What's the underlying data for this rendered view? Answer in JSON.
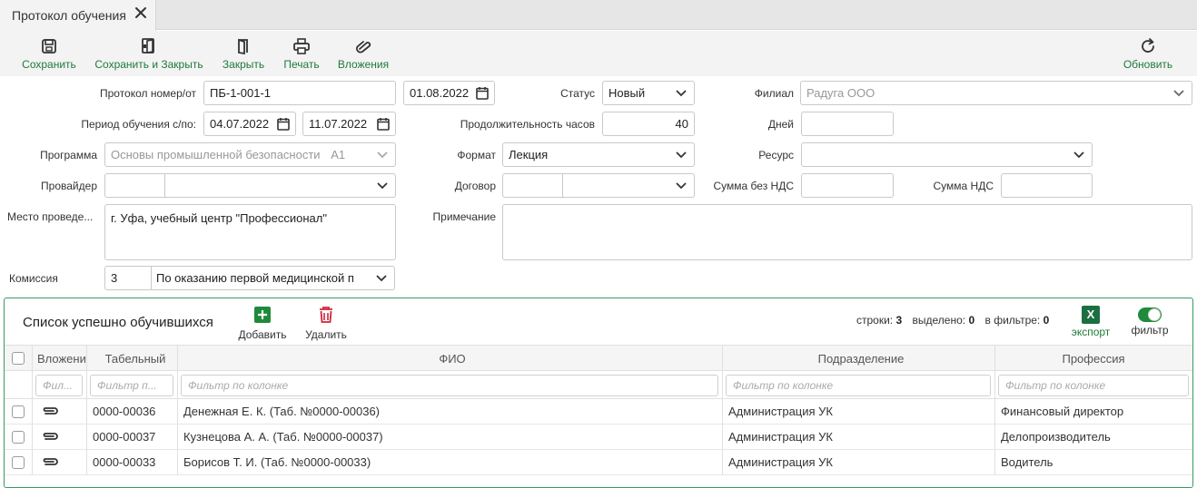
{
  "tab": {
    "title": "Протокол обучения"
  },
  "toolbar": {
    "save": "Сохранить",
    "save_close": "Сохранить и Закрыть",
    "close": "Закрыть",
    "print": "Печать",
    "attachments": "Вложения",
    "refresh": "Обновить"
  },
  "form": {
    "protocol_label": "Протокол номер/от",
    "protocol_number": "ПБ-1-001-1",
    "protocol_date": "01.08.2022",
    "period_label": "Период обучения с/по:",
    "period_from": "04.07.2022",
    "period_to": "11.07.2022",
    "program_label": "Программа",
    "program_value": "Основы промышленной безопасности",
    "program_code": "А1",
    "provider_label": "Провайдер",
    "place_label": "Место проведе...",
    "place_value": "г. Уфа, учебный центр \"Профессионал\"",
    "commission_label": "Комиссия",
    "commission_code": "3",
    "commission_value": "По оказанию первой медицинской п",
    "status_label": "Статус",
    "status_value": "Новый",
    "duration_label": "Продолжительность часов",
    "duration_value": "40",
    "format_label": "Формат",
    "format_value": "Лекция",
    "contract_label": "Договор",
    "note_label": "Примечание",
    "branch_label": "Филиал",
    "branch_value": "Радуга ООО",
    "days_label": "Дней",
    "resource_label": "Ресурс",
    "sum_no_vat_label": "Сумма без НДС",
    "vat_label": "Сумма НДС"
  },
  "panel": {
    "title": "Список успешно обучившихся",
    "add": "Добавить",
    "delete": "Удалить",
    "rows_label": "строки:",
    "rows_count": "3",
    "selected_label": "выделено:",
    "selected_count": "0",
    "in_filter_label": "в фильтре:",
    "in_filter_count": "0",
    "excel_icon_letter": "X",
    "export": "экспорт",
    "filter": "фильтр"
  },
  "grid": {
    "columns": {
      "attachments": "Вложени",
      "tab_number": "Табельный",
      "fio": "ФИО",
      "department": "Подразделение",
      "profession": "Профессия"
    },
    "filters": {
      "attachments": "Фил...",
      "tab_number": "Фильтр п...",
      "fio": "Фильтр по колонке",
      "department": "Фильтр по колонке",
      "profession": "Фильтр по колонке"
    },
    "rows": [
      {
        "tab_number": "0000-00036",
        "fio": "Денежная Е. К. (Таб. №0000-00036)",
        "department": "Администрация УК",
        "profession": "Финансовый директор"
      },
      {
        "tab_number": "0000-00037",
        "fio": "Кузнецова А. А. (Таб. №0000-00037)",
        "department": "Администрация УК",
        "profession": "Делопроизводитель"
      },
      {
        "tab_number": "0000-00033",
        "fio": "Борисов Т. И. (Таб. №0000-00033)",
        "department": "Администрация УК",
        "profession": "Водитель"
      }
    ]
  },
  "colors": {
    "accent_green": "#1f7a3a",
    "excel_green": "#1d6f42",
    "delete_red": "#d0243a"
  }
}
